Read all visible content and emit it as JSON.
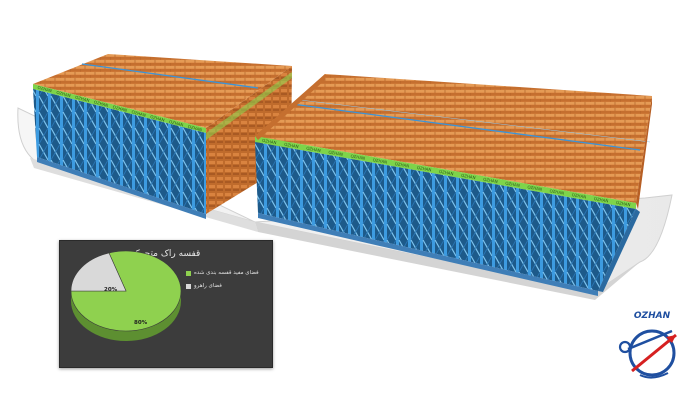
{
  "inset_chart": {
    "title": "قفسه راک متحرک",
    "legend": [
      {
        "label": "فضای مفید قفسه بندی شده",
        "color": "#8fd14f"
      },
      {
        "label": "فضای راهرو",
        "color": "#d9d9d9"
      }
    ],
    "slice_labels": [
      "80%",
      "20%"
    ]
  },
  "chart_data": {
    "type": "pie",
    "title": "قفسه راک متحرک",
    "categories": [
      "فضای مفید قفسه بندی شده",
      "فضای راهرو"
    ],
    "values": [
      80,
      20
    ],
    "colors": [
      "#8fd14f",
      "#d9d9d9"
    ],
    "legend_position": "right"
  },
  "rack_label_text": "OZHAN",
  "logo": {
    "text": "OZHAN",
    "color": "#1f4fa0",
    "accent": "#d62020"
  }
}
